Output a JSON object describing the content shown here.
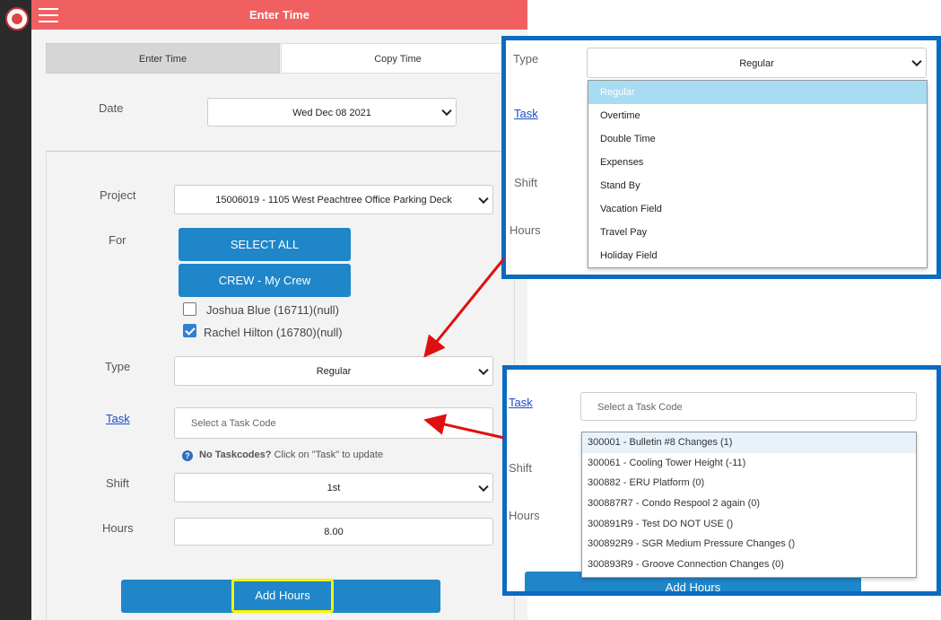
{
  "header": {
    "title": "Enter Time"
  },
  "tabs": [
    {
      "label": "Enter Time"
    },
    {
      "label": "Copy Time"
    }
  ],
  "date": {
    "label": "Date",
    "value": "Wed Dec 08 2021"
  },
  "project": {
    "label": "Project",
    "value": "15006019 - 1105 West Peachtree Office Parking Deck"
  },
  "for": {
    "label": "For",
    "select_all_label": "SELECT ALL",
    "crew_label": "CREW - My Crew",
    "members": [
      {
        "name": "Joshua Blue (16711)(null)",
        "checked": false
      },
      {
        "name": "Rachel Hilton (16780)(null)",
        "checked": true
      }
    ]
  },
  "type": {
    "label": "Type",
    "value": "Regular"
  },
  "task": {
    "label": "Task",
    "placeholder": "Select a Task Code"
  },
  "hint": {
    "bold": "No Taskcodes?",
    "text": " Click on \"Task\" to update"
  },
  "shift": {
    "label": "Shift",
    "value": "1st"
  },
  "hours": {
    "label": "Hours",
    "value": "8.00"
  },
  "add_hours_label": "Add Hours",
  "callout_type": {
    "type_label": "Type",
    "selected": "Regular",
    "task_label": "Task",
    "shift_label": "Shift",
    "hours_label": "Hours",
    "options": [
      "Regular",
      "Overtime",
      "Double Time",
      "Expenses",
      "Stand By",
      "Vacation Field",
      "Travel Pay",
      "Holiday Field"
    ]
  },
  "callout_task": {
    "task_label": "Task",
    "placeholder": "Select a Task Code",
    "shift_label": "Shift",
    "hours_label": "Hours",
    "add_hours_label": "Add Hours",
    "codes": [
      "300001 - Bulletin #8 Changes (1)",
      "300061 - Cooling Tower Height (-11)",
      "300882 - ERU Platform (0)",
      "300887R7 - Condo Respool 2 again (0)",
      "300891R9 - Test DO NOT USE ()",
      "300892R9 - SGR Medium Pressure Changes ()",
      "300893R9 - Groove Connection Changes (0)"
    ]
  },
  "colors": {
    "header": "#f06060",
    "accent": "#1f86c9",
    "callout_border": "#0a6bc0",
    "highlight": "#f5f500",
    "arrow": "#e01010"
  }
}
